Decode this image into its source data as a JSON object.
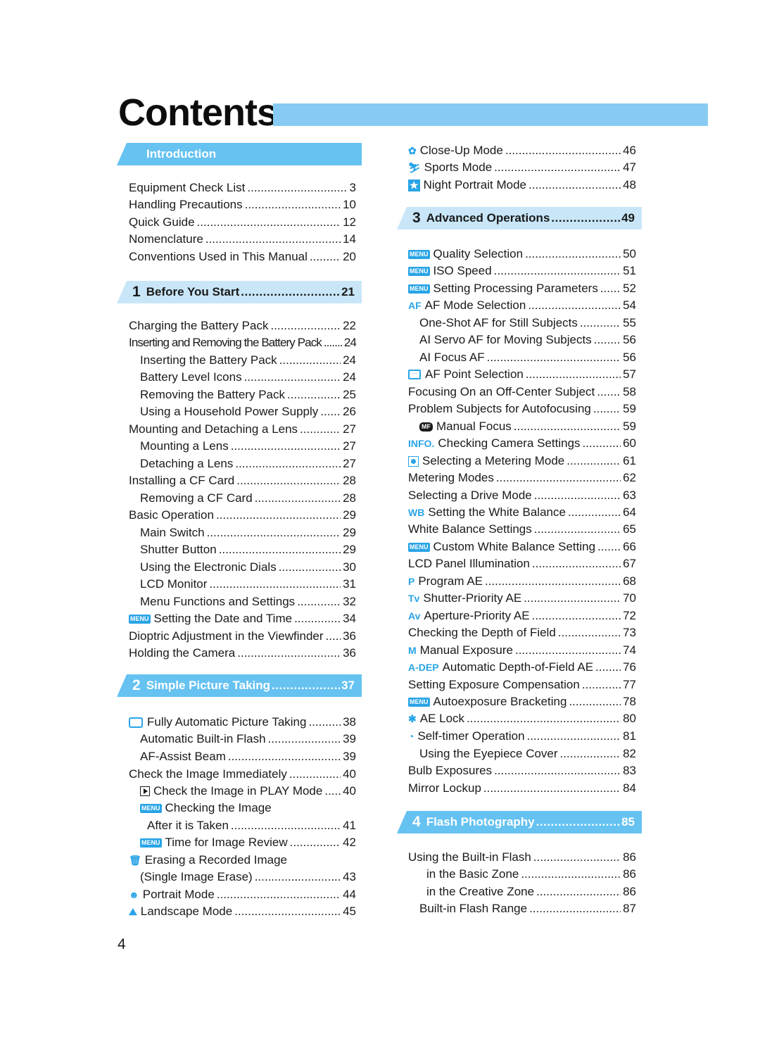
{
  "page": {
    "title": "Contents",
    "page_number": "4",
    "accent_color": "#65c2f1",
    "light_accent_color": "#c8e6f8"
  },
  "left": {
    "sections": [
      {
        "num": "",
        "label": "Introduction",
        "page": ""
      },
      {
        "num": "1",
        "label": "Before You Start",
        "page": "21"
      },
      {
        "num": "2",
        "label": "Simple Picture Taking",
        "page": "37"
      }
    ],
    "rows": [
      {
        "icon": "",
        "text": "Equipment Check List",
        "page": "3"
      },
      {
        "icon": "",
        "text": "Handling Precautions",
        "page": "10"
      },
      {
        "icon": "",
        "text": "Quick Guide",
        "page": "12"
      },
      {
        "icon": "",
        "text": "Nomenclature",
        "page": "14"
      },
      {
        "icon": "",
        "text": "Conventions Used in This Manual",
        "page": "20"
      },
      {
        "icon": "",
        "text": "Charging the Battery Pack",
        "page": "22"
      },
      {
        "icon": "",
        "text": "Inserting and Removing the Battery Pack",
        "page": "24"
      },
      {
        "icon": "",
        "text": "Inserting the Battery Pack",
        "page": "24"
      },
      {
        "icon": "",
        "text": "Battery Level Icons",
        "page": "24"
      },
      {
        "icon": "",
        "text": "Removing the Battery Pack",
        "page": "25"
      },
      {
        "icon": "",
        "text": "Using a Household Power Supply",
        "page": "26"
      },
      {
        "icon": "",
        "text": "Mounting and Detaching a Lens",
        "page": "27"
      },
      {
        "icon": "",
        "text": "Mounting a Lens",
        "page": "27"
      },
      {
        "icon": "",
        "text": "Detaching a Lens",
        "page": "27"
      },
      {
        "icon": "",
        "text": "Installing a CF Card",
        "page": "28"
      },
      {
        "icon": "",
        "text": "Removing a CF Card",
        "page": "28"
      },
      {
        "icon": "",
        "text": "Basic Operation",
        "page": "29"
      },
      {
        "icon": "",
        "text": "Main Switch",
        "page": "29"
      },
      {
        "icon": "",
        "text": "Shutter Button",
        "page": "29"
      },
      {
        "icon": "",
        "text": "Using the Electronic Dials",
        "page": "30"
      },
      {
        "icon": "",
        "text": "LCD Monitor",
        "page": "31"
      },
      {
        "icon": "",
        "text": "Menu Functions and Settings",
        "page": "32"
      },
      {
        "icon": "MENU",
        "text": "Setting the Date and Time",
        "page": "34"
      },
      {
        "icon": "",
        "text": "Dioptric Adjustment in the Viewfinder",
        "page": "36"
      },
      {
        "icon": "",
        "text": "Holding the Camera",
        "page": "36"
      },
      {
        "icon": "",
        "text": "Fully Automatic Picture Taking",
        "page": "38"
      },
      {
        "icon": "",
        "text": "Automatic Built-in Flash",
        "page": "39"
      },
      {
        "icon": "",
        "text": "AF-Assist Beam",
        "page": "39"
      },
      {
        "icon": "",
        "text": "Check the Image Immediately",
        "page": "40"
      },
      {
        "icon": "",
        "text": "Check the Image in PLAY Mode",
        "page": "40"
      },
      {
        "icon": "MENU",
        "text": "Checking the Image",
        "page": ""
      },
      {
        "icon": "",
        "text": "After it is Taken",
        "page": "41"
      },
      {
        "icon": "MENU",
        "text": "Time for Image Review",
        "page": "42"
      },
      {
        "icon": "",
        "text": "Erasing a Recorded Image",
        "page": ""
      },
      {
        "icon": "",
        "text": "(Single Image Erase)",
        "page": "43"
      },
      {
        "icon": "",
        "text": "Portrait Mode",
        "page": "44"
      },
      {
        "icon": "",
        "text": "Landscape Mode",
        "page": "45"
      }
    ]
  },
  "right": {
    "sections": [
      {
        "num": "3",
        "label": "Advanced Operations",
        "page": "49"
      },
      {
        "num": "4",
        "label": "Flash Photography",
        "page": "85"
      }
    ],
    "rows": [
      {
        "icon": "",
        "text": "Close-Up Mode",
        "page": "46"
      },
      {
        "icon": "",
        "text": "Sports Mode",
        "page": "47"
      },
      {
        "icon": "",
        "text": "Night Portrait Mode",
        "page": "48"
      },
      {
        "icon": "MENU",
        "text": "Quality Selection",
        "page": "50"
      },
      {
        "icon": "MENU",
        "text": "ISO Speed",
        "page": "51"
      },
      {
        "icon": "MENU",
        "text": "Setting Processing Parameters",
        "page": "52"
      },
      {
        "icon": "AF",
        "text": "AF Mode Selection",
        "page": "54"
      },
      {
        "icon": "",
        "text": "One-Shot AF for Still Subjects",
        "page": "55"
      },
      {
        "icon": "",
        "text": "AI Servo AF for Moving Subjects",
        "page": "56"
      },
      {
        "icon": "",
        "text": "AI Focus AF",
        "page": "56"
      },
      {
        "icon": "",
        "text": "AF Point Selection",
        "page": "57"
      },
      {
        "icon": "",
        "text": "Focusing On an Off-Center Subject",
        "page": "58"
      },
      {
        "icon": "",
        "text": "Problem Subjects for Autofocusing",
        "page": "59"
      },
      {
        "icon": "MF",
        "text": "Manual Focus",
        "page": "59"
      },
      {
        "icon": "INFO.",
        "text": "Checking Camera Settings",
        "page": "60"
      },
      {
        "icon": "",
        "text": "Selecting a Metering Mode",
        "page": "61"
      },
      {
        "icon": "",
        "text": "Metering Modes",
        "page": "62"
      },
      {
        "icon": "",
        "text": "Selecting a Drive Mode",
        "page": "63"
      },
      {
        "icon": "WB",
        "text": "Setting the White Balance",
        "page": "64"
      },
      {
        "icon": "",
        "text": "White Balance Settings",
        "page": "65"
      },
      {
        "icon": "MENU",
        "text": "Custom White Balance Setting",
        "page": "66"
      },
      {
        "icon": "",
        "text": "LCD Panel Illumination",
        "page": "67"
      },
      {
        "icon": "P",
        "text": "Program AE",
        "page": "68"
      },
      {
        "icon": "Tv",
        "text": "Shutter-Priority AE",
        "page": "70"
      },
      {
        "icon": "Av",
        "text": "Aperture-Priority AE",
        "page": "72"
      },
      {
        "icon": "",
        "text": "Checking the Depth of Field",
        "page": "73"
      },
      {
        "icon": "M",
        "text": "Manual Exposure",
        "page": "74"
      },
      {
        "icon": "A-DEP",
        "text": "Automatic Depth-of-Field AE",
        "page": "76"
      },
      {
        "icon": "",
        "text": "Setting Exposure Compensation",
        "page": "77"
      },
      {
        "icon": "MENU",
        "text": "Autoexposure Bracketing",
        "page": "78"
      },
      {
        "icon": "✱",
        "text": "AE Lock",
        "page": "80"
      },
      {
        "icon": "",
        "text": "Self-timer Operation",
        "page": "81"
      },
      {
        "icon": "",
        "text": "Using the Eyepiece Cover",
        "page": "82"
      },
      {
        "icon": "",
        "text": "Bulb Exposures",
        "page": "83"
      },
      {
        "icon": "",
        "text": "Mirror Lockup",
        "page": "84"
      },
      {
        "icon": "",
        "text": "Using the Built-in Flash",
        "page": "86"
      },
      {
        "icon": "",
        "text": "in the Basic Zone",
        "page": "86"
      },
      {
        "icon": "",
        "text": "in the Creative Zone",
        "page": "86"
      },
      {
        "icon": "",
        "text": "Built-in Flash Range",
        "page": "87"
      }
    ]
  }
}
